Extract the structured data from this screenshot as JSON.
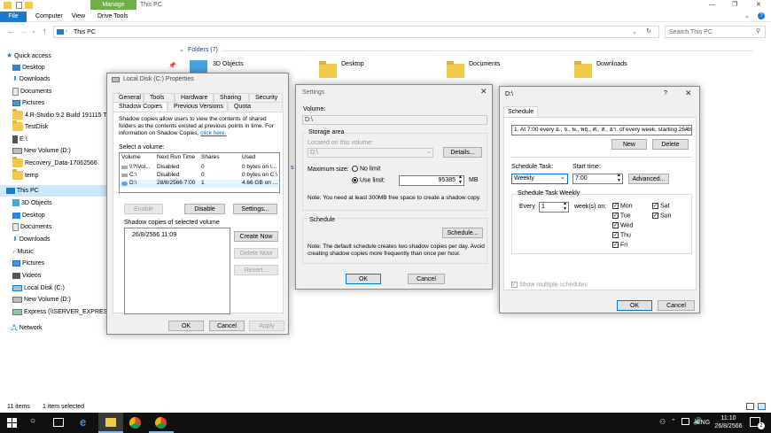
{
  "titlebar": {
    "manage_label": "Manage",
    "title": "This PC"
  },
  "ribbon": {
    "tabs": [
      "File",
      "Computer",
      "View",
      "Drive Tools"
    ]
  },
  "address": {
    "path": "This PC",
    "search_placeholder": "Search This PC"
  },
  "nav": {
    "items": [
      "Quick access",
      "Desktop",
      "Downloads",
      "Documents",
      "Pictures",
      "4.R-Studio 9.2 Build 191115 Tech",
      "TestDisk",
      "E:\\",
      "New Volume (D:)",
      "Recovery_Data-17062566",
      "temp",
      "This PC",
      "3D Objects",
      "Desktop",
      "Documents",
      "Downloads",
      "Music",
      "Pictures",
      "Videos",
      "Local Disk (C:)",
      "New Volume (D:)",
      "Express (\\\\SERVER_EXPRESS) (Z:)",
      "Network"
    ]
  },
  "content": {
    "folders_header": "Folders (7)",
    "folders": [
      "3D Objects",
      "Desktop",
      "Documents",
      "Downloads"
    ],
    "partial_text": "s (5)"
  },
  "statusbar": {
    "items": "11 items",
    "selected": "1 item selected"
  },
  "props": {
    "title": "Local Disk (C:) Properties",
    "tabs_row1": [
      "General",
      "Tools",
      "Hardware",
      "Sharing",
      "Security"
    ],
    "tabs_row2": [
      "Shadow Copies",
      "Previous Versions",
      "Quota"
    ],
    "description": "Shadow copies allow users to view the contents of shared folders as the contents existed at previous points in time. For information on Shadow Copies,",
    "description_link": "click here.",
    "select_label": "Select a volume:",
    "columns": [
      "Volume",
      "Next Run Time",
      "Shares",
      "Used"
    ],
    "rows": [
      [
        "\\\\?\\Vol...",
        "Disabled",
        "0",
        "0 bytes on \\..."
      ],
      [
        "C:\\",
        "Disabled",
        "0",
        "0 bytes on C:\\"
      ],
      [
        "D:\\",
        "28/8/2566 7:00",
        "1",
        "4.66 GB on ..."
      ]
    ],
    "enable": "Enable",
    "disable": "Disable",
    "settings": "Settings...",
    "copies_label": "Shadow copies of selected volume",
    "copies": [
      "26/8/2566 11:09"
    ],
    "create_now": "Create Now",
    "delete_now": "Delete Now",
    "revert": "Revert...",
    "ok": "OK",
    "cancel": "Cancel",
    "apply": "Apply"
  },
  "settings": {
    "title": "Settings",
    "volume_label": "Volume:",
    "volume_value": "D:\\",
    "storage_label": "Storage area",
    "located_label": "Located on this volume:",
    "located_value": "D:\\",
    "details": "Details...",
    "max_label": "Maximum size:",
    "no_limit": "No limit",
    "use_limit": "Use limit:",
    "limit_value": "95385",
    "mb": "MB",
    "note1": "Note: You need at least 300MB free space to create a shadow copy.",
    "schedule_label": "Schedule",
    "schedule_btn": "Schedule...",
    "note2": "Note: The default schedule creates two shadow copies per day. Avoid creating shadow copies more frequently than once per hour.",
    "ok": "OK",
    "cancel": "Cancel"
  },
  "schedule": {
    "title": "D:\\",
    "help": "?",
    "tab": "Schedule",
    "dropdown": "1. At 7:00 every อ., จ., พ., พฤ., ศ., ส., อา. of every week, starting 26/8/...",
    "new": "New",
    "delete": "Delete",
    "task_label": "Schedule Task:",
    "task_value": "Weekly",
    "start_label": "Start time:",
    "start_value": "7:00",
    "advanced": "Advanced...",
    "weekly_group": "Schedule Task Weekly",
    "every": "Every",
    "every_value": "1",
    "weeks_on": "week(s) on:",
    "days_col1": [
      "Mon",
      "Tue",
      "Wed",
      "Thu",
      "Fri"
    ],
    "days_col2": [
      "Sat",
      "Sun"
    ],
    "show_multiple": "Show multiple schedules",
    "ok": "OK",
    "cancel": "Cancel"
  },
  "taskbar": {
    "lang": "ENG",
    "time": "11:10",
    "date": "26/8/2566",
    "notif": "2"
  }
}
